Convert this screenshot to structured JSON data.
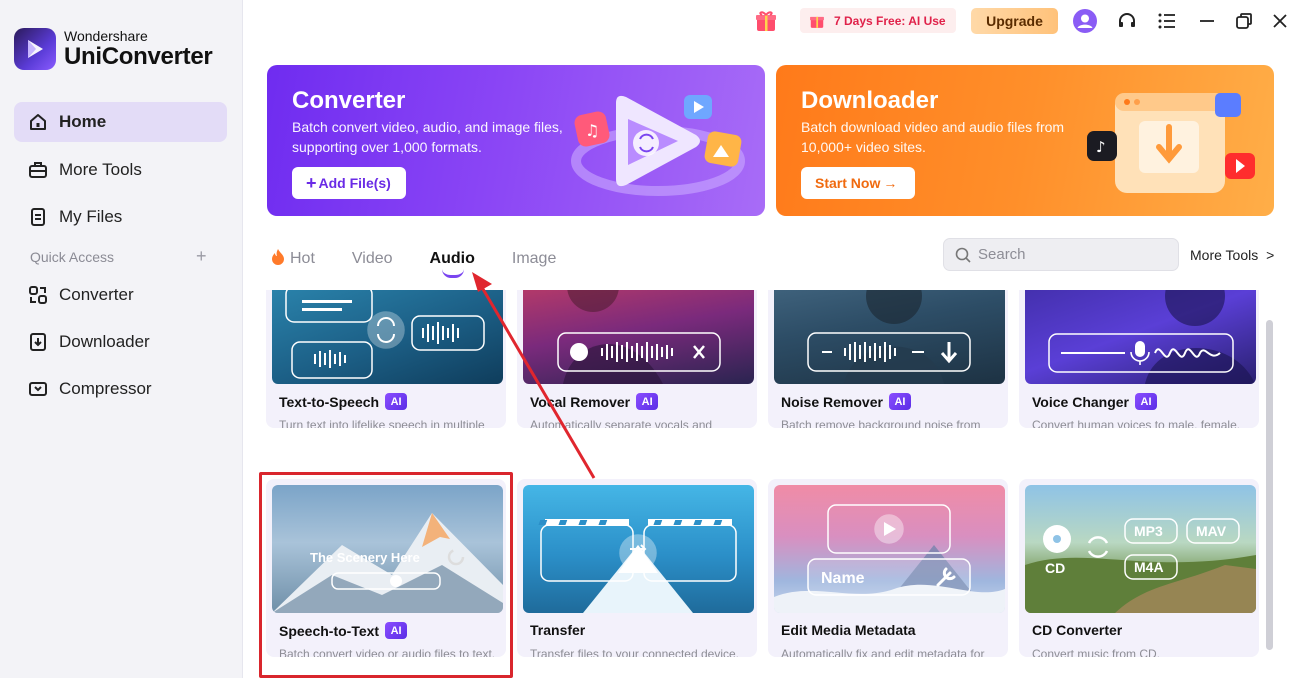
{
  "brand": {
    "small": "Wondershare",
    "big": "UniConverter"
  },
  "sidebar": {
    "items": [
      {
        "label": "Home",
        "icon": "home-icon"
      },
      {
        "label": "More Tools",
        "icon": "toolbox-icon"
      },
      {
        "label": "My Files",
        "icon": "file-icon"
      }
    ],
    "quick_access_label": "Quick Access",
    "quick_items": [
      {
        "label": "Converter",
        "icon": "converter-icon"
      },
      {
        "label": "Downloader",
        "icon": "downloader-icon"
      },
      {
        "label": "Compressor",
        "icon": "compressor-icon"
      }
    ]
  },
  "topbar": {
    "promo": "7 Days Free: AI Use",
    "upgrade": "Upgrade"
  },
  "banners": {
    "converter": {
      "title": "Converter",
      "desc": "Batch convert video, audio, and image files, supporting over 1,000 formats.",
      "button": "Add File(s)"
    },
    "downloader": {
      "title": "Downloader",
      "desc": "Batch download video and audio files from 10,000+ video sites.",
      "button": "Start Now"
    }
  },
  "tabs": [
    {
      "label": "Hot"
    },
    {
      "label": "Video"
    },
    {
      "label": "Audio"
    },
    {
      "label": "Image"
    }
  ],
  "active_tab": "Audio",
  "search": {
    "placeholder": "Search"
  },
  "more_tools": "More Tools",
  "cards": [
    {
      "title": "Text-to-Speech",
      "ai": "AI",
      "desc": "Turn text into lifelike speech in multiple languages via AI, with voice transforma..."
    },
    {
      "title": "Vocal Remover",
      "ai": "AI",
      "desc": "Automatically separate vocals and background music from video or audio..."
    },
    {
      "title": "Noise Remover",
      "ai": "AI",
      "desc": "Batch remove background noise from video or audio files."
    },
    {
      "title": "Voice Changer",
      "ai": "AI",
      "desc": "Convert human voices to male, female, child, robot and more."
    },
    {
      "title": "Speech-to-Text",
      "ai": "AI",
      "desc": "Batch convert video or audio files to text.",
      "thumb_text": "The Scenery Here"
    },
    {
      "title": "Transfer",
      "desc": "Transfer files to your connected device."
    },
    {
      "title": "Edit Media Metadata",
      "desc": "Automatically fix and edit metadata for media files.",
      "thumb_text": "Name"
    },
    {
      "title": "CD Converter",
      "desc": "Convert music from CD.",
      "thumb_labels": [
        "MP3",
        "MAV",
        "M4A",
        "CD"
      ]
    }
  ],
  "colors": {
    "accent": "#7a45f0",
    "highlight": "#d9262d",
    "converter": "#7b36f2",
    "downloader": "#ff8a25"
  }
}
